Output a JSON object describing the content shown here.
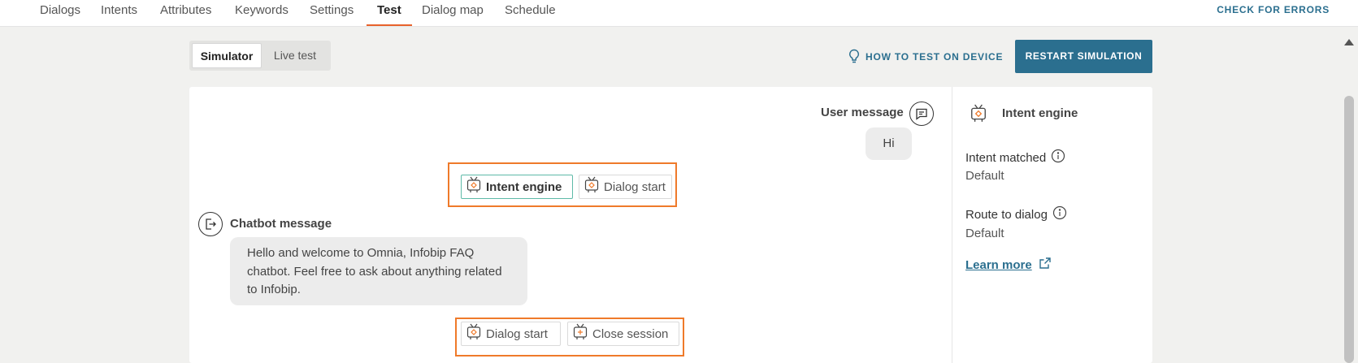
{
  "nav": {
    "tabs": [
      {
        "label": "Dialogs"
      },
      {
        "label": "Intents"
      },
      {
        "label": "Attributes"
      },
      {
        "label": "Keywords"
      },
      {
        "label": "Settings"
      },
      {
        "label": "Test"
      },
      {
        "label": "Dialog map"
      },
      {
        "label": "Schedule"
      }
    ],
    "active_tab": "Test",
    "check_errors": "CHECK FOR ERRORS"
  },
  "toolbar": {
    "mode_simulator": "Simulator",
    "mode_live": "Live test",
    "active_mode": "Simulator",
    "how_to": "HOW TO TEST ON DEVICE",
    "restart": "RESTART SIMULATION"
  },
  "conversation": {
    "user_label": "User message",
    "user_text": "Hi",
    "chips_top": [
      {
        "label": "Intent engine",
        "icon": "robot-icon",
        "selected": true
      },
      {
        "label": "Dialog start",
        "icon": "robot-icon",
        "selected": false
      }
    ],
    "bot_label": "Chatbot message",
    "bot_text": "Hello and welcome to Omnia, Infobip FAQ chatbot. Feel free to ask about anything related to Infobip.",
    "chips_bottom": [
      {
        "label": "Dialog start",
        "icon": "robot-icon"
      },
      {
        "label": "Close session",
        "icon": "robot-icon"
      }
    ]
  },
  "sidebar": {
    "title": "Intent engine",
    "intent_label": "Intent matched",
    "intent_value": "Default",
    "route_label": "Route to dialog",
    "route_value": "Default",
    "learn_more": "Learn more"
  },
  "colors": {
    "accent": "#2b6f8f",
    "highlight": "#ef7a2a",
    "active_tab_underline": "#e8622b",
    "selected_chip_border": "#5ebaa8"
  }
}
